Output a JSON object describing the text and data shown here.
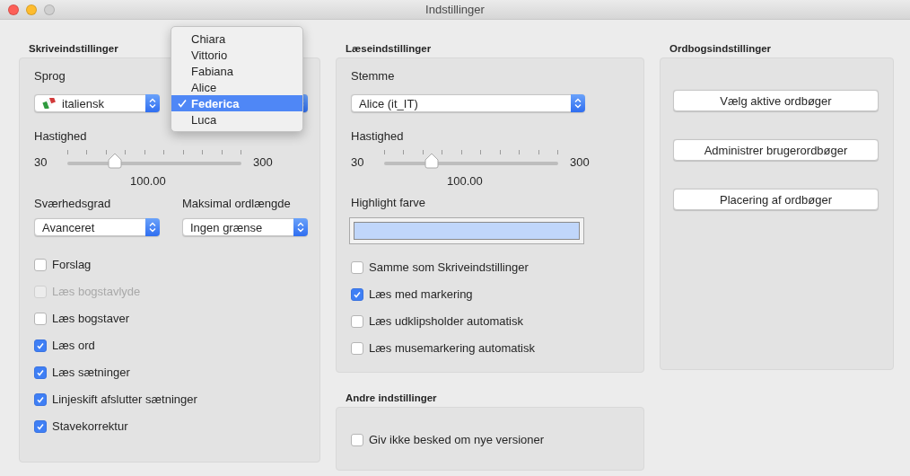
{
  "window": {
    "title": "Indstillinger"
  },
  "writing": {
    "title": "Skriveindstillinger",
    "language_label": "Sprog",
    "language": "italiensk",
    "voice_menu": [
      {
        "label": "Chiara",
        "selected": false
      },
      {
        "label": "Vittorio",
        "selected": false
      },
      {
        "label": "Fabiana",
        "selected": false
      },
      {
        "label": "Alice",
        "selected": false
      },
      {
        "label": "Federica",
        "selected": true
      },
      {
        "label": "Luca",
        "selected": false
      }
    ],
    "speed": {
      "label": "Hastighed",
      "min": "30",
      "max": "300",
      "level": 0.26,
      "reading": "100.00"
    },
    "difficulty": {
      "label": "Sværhedsgrad",
      "value": "Avanceret"
    },
    "max_length": {
      "label": "Maksimal ordlængde",
      "value": "Ingen grænse"
    },
    "options": [
      {
        "label": "Forslag",
        "checked": false,
        "disabled": false
      },
      {
        "label": "Læs bogstavlyde",
        "checked": false,
        "disabled": true
      },
      {
        "label": "Læs bogstaver",
        "checked": false,
        "disabled": false
      },
      {
        "label": "Læs ord",
        "checked": true,
        "disabled": false
      },
      {
        "label": "Læs sætninger",
        "checked": true,
        "disabled": false
      },
      {
        "label": "Linjeskift afslutter sætninger",
        "checked": true,
        "disabled": false
      },
      {
        "label": "Stavekorrektur",
        "checked": true,
        "disabled": false
      }
    ]
  },
  "reading": {
    "title": "Læseindstillinger",
    "voice_label": "Stemme",
    "voice": "Alice (it_IT)",
    "speed": {
      "label": "Hastighed",
      "min": "30",
      "max": "300",
      "level": 0.26,
      "reading": "100.00"
    },
    "highlight": {
      "label": "Highlight farve",
      "color": "#c0d6fa"
    },
    "options": [
      {
        "label": "Samme som Skriveindstillinger",
        "checked": false,
        "disabled": false
      },
      {
        "label": "Læs med markering",
        "checked": true,
        "disabled": false
      },
      {
        "label": "Læs udklipsholder automatisk",
        "checked": false,
        "disabled": false
      },
      {
        "label": "Læs musemarkering automatisk",
        "checked": false,
        "disabled": false
      }
    ]
  },
  "dictionary": {
    "title": "Ordbogsindstillinger",
    "buttons": [
      "Vælg aktive ordbøger",
      "Administrer brugerordbøger",
      "Placering af ordbøger"
    ]
  },
  "other": {
    "title": "Andre indstillinger",
    "options": [
      {
        "label": "Giv ikke besked om nye versioner",
        "checked": false,
        "disabled": false
      }
    ]
  }
}
